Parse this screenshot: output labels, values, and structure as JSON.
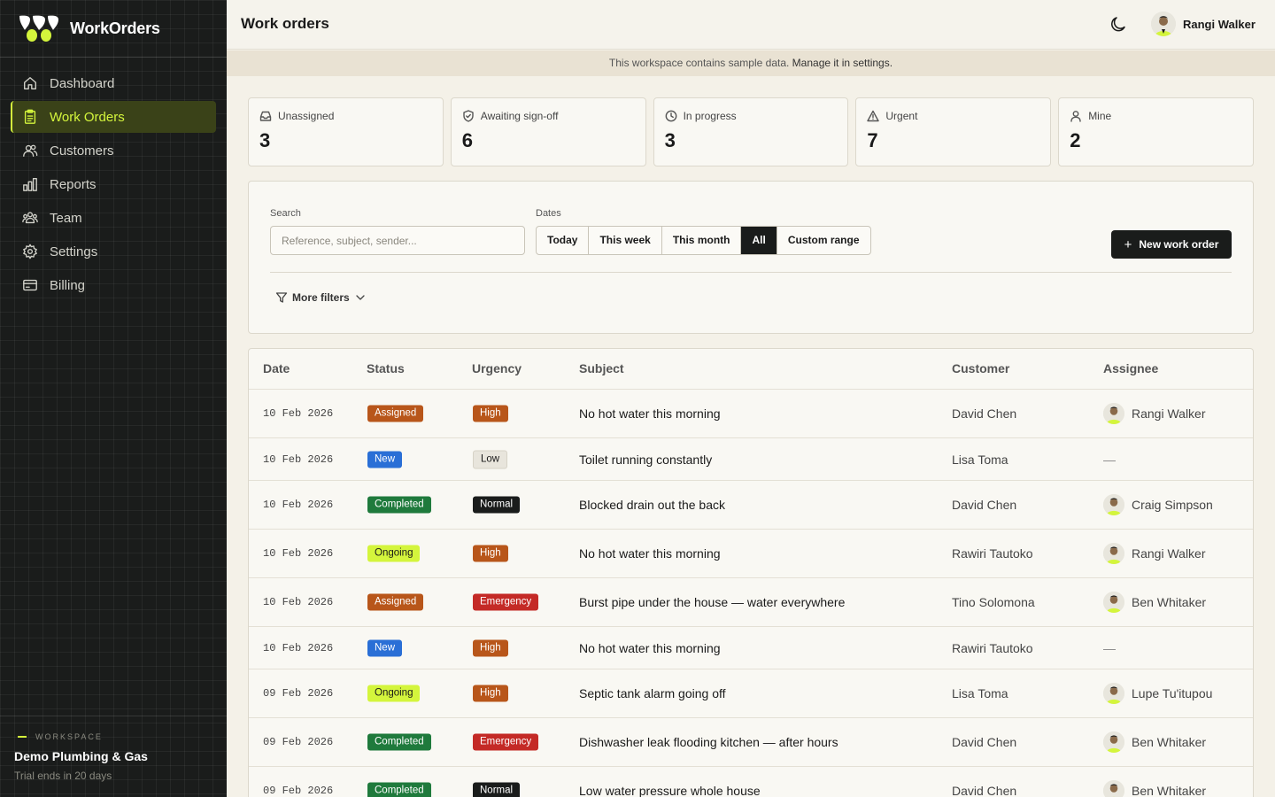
{
  "app": {
    "name": "WorkOrders"
  },
  "sidebar": {
    "items": [
      {
        "label": "Dashboard",
        "icon": "home-icon"
      },
      {
        "label": "Work Orders",
        "icon": "clipboard-icon",
        "active": true
      },
      {
        "label": "Customers",
        "icon": "users-icon"
      },
      {
        "label": "Reports",
        "icon": "bar-chart-icon"
      },
      {
        "label": "Team",
        "icon": "team-icon"
      },
      {
        "label": "Settings",
        "icon": "gear-icon"
      },
      {
        "label": "Billing",
        "icon": "credit-card-icon"
      }
    ],
    "workspace": {
      "label": "WORKSPACE",
      "name": "Demo Plumbing & Gas",
      "trial": "Trial ends in 20 days"
    }
  },
  "header": {
    "title": "Work orders",
    "user_name": "Rangi Walker"
  },
  "banner": {
    "text": "This workspace contains sample data. ",
    "link": "Manage it in settings."
  },
  "stats": [
    {
      "label": "Unassigned",
      "value": "3",
      "icon": "inbox-icon"
    },
    {
      "label": "Awaiting sign-off",
      "value": "6",
      "icon": "shield-check-icon"
    },
    {
      "label": "In progress",
      "value": "3",
      "icon": "clock-icon"
    },
    {
      "label": "Urgent",
      "value": "7",
      "icon": "warning-icon"
    },
    {
      "label": "Mine",
      "value": "2",
      "icon": "user-icon"
    }
  ],
  "filters": {
    "search_label": "Search",
    "search_placeholder": "Reference, subject, sender...",
    "dates_label": "Dates",
    "date_options": [
      "Today",
      "This week",
      "This month",
      "All",
      "Custom range"
    ],
    "active_date": "All",
    "new_button": "New work order",
    "more_filters": "More filters"
  },
  "table": {
    "columns": [
      "Date",
      "Status",
      "Urgency",
      "Subject",
      "Customer",
      "Assignee"
    ],
    "rows": [
      {
        "date": "10 Feb 2026",
        "status": "Assigned",
        "urgency": "High",
        "subject": "No hot water this morning",
        "customer": "David Chen",
        "assignee": "Rangi Walker"
      },
      {
        "date": "10 Feb 2026",
        "status": "New",
        "urgency": "Low",
        "subject": "Toilet running constantly",
        "customer": "Lisa Toma",
        "assignee": "—"
      },
      {
        "date": "10 Feb 2026",
        "status": "Completed",
        "urgency": "Normal",
        "subject": "Blocked drain out the back",
        "customer": "David Chen",
        "assignee": "Craig Simpson"
      },
      {
        "date": "10 Feb 2026",
        "status": "Ongoing",
        "urgency": "High",
        "subject": "No hot water this morning",
        "customer": "Rawiri Tautoko",
        "assignee": "Rangi Walker"
      },
      {
        "date": "10 Feb 2026",
        "status": "Assigned",
        "urgency": "Emergency",
        "subject": "Burst pipe under the house — water everywhere",
        "customer": "Tino Solomona",
        "assignee": "Ben Whitaker"
      },
      {
        "date": "10 Feb 2026",
        "status": "New",
        "urgency": "High",
        "subject": "No hot water this morning",
        "customer": "Rawiri Tautoko",
        "assignee": "—"
      },
      {
        "date": "09 Feb 2026",
        "status": "Ongoing",
        "urgency": "High",
        "subject": "Septic tank alarm going off",
        "customer": "Lisa Toma",
        "assignee": "Lupe Tu'itupou"
      },
      {
        "date": "09 Feb 2026",
        "status": "Completed",
        "urgency": "Emergency",
        "subject": "Dishwasher leak flooding kitchen — after hours",
        "customer": "David Chen",
        "assignee": "Ben Whitaker"
      },
      {
        "date": "09 Feb 2026",
        "status": "Completed",
        "urgency": "Normal",
        "subject": "Low water pressure whole house",
        "customer": "David Chen",
        "assignee": "Ben Whitaker"
      }
    ]
  },
  "colors": {
    "accent": "#d4f53c",
    "sidebar_bg": "#1a1c1b",
    "status": {
      "Assigned": "#b8561a",
      "New": "#2a6fd6",
      "Completed": "#1f7a3c",
      "Ongoing": "#d4f53c"
    },
    "urgency": {
      "High": "#b8561a",
      "Low": "#e8e5dc",
      "Normal": "#1a1c1b",
      "Emergency": "#c42a26"
    }
  }
}
